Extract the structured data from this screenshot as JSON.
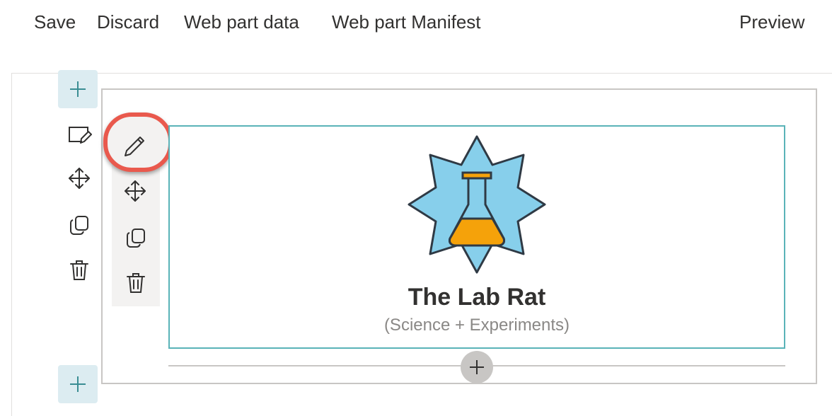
{
  "toolbar": {
    "save_label": "Save",
    "discard_label": "Discard",
    "webpart_data_label": "Web part data",
    "webpart_manifest_label": "Web part Manifest",
    "preview_label": "Preview"
  },
  "section_toolbar": {
    "icons": [
      "edit-section-icon",
      "move-icon",
      "duplicate-icon",
      "delete-icon"
    ]
  },
  "webpart_toolbar": {
    "icons": [
      "pencil-icon",
      "move-icon",
      "duplicate-icon",
      "delete-icon"
    ]
  },
  "webpart": {
    "title": "The Lab Rat",
    "subtitle": "(Science + Experiments)",
    "logo_icon": "flask-star-logo"
  },
  "colors": {
    "accent_teal": "#5ab3b8",
    "highlight_red": "#e9594d",
    "star_blue": "#87cfeb",
    "flask_orange": "#f5a20a"
  }
}
